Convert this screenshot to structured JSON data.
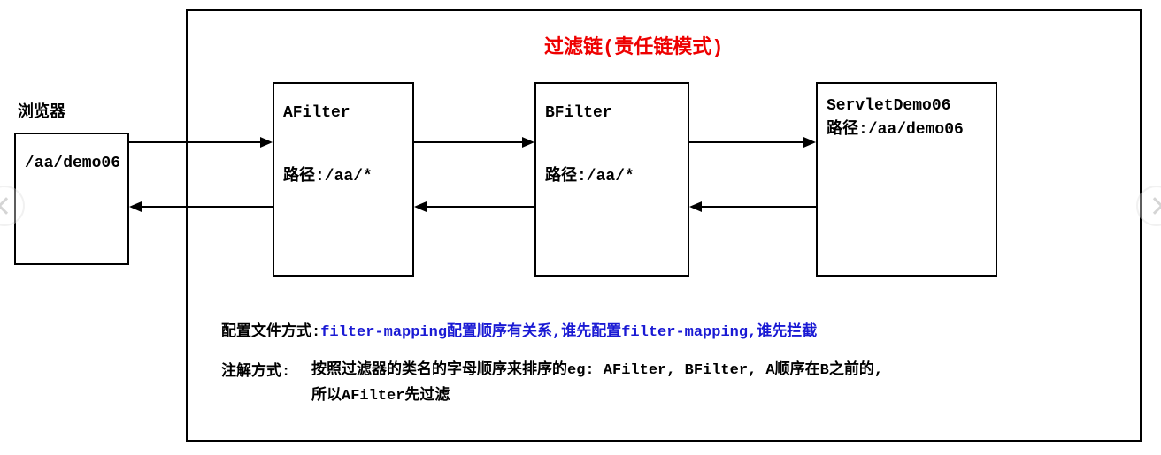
{
  "title": "过滤链(责任链模式)",
  "browser": {
    "label": "浏览器",
    "path": "/aa/demo06"
  },
  "boxes": {
    "afilter": {
      "name": "AFilter",
      "path_label": "路径:/aa/*"
    },
    "bfilter": {
      "name": "BFilter",
      "path_label": "路径:/aa/*"
    },
    "servlet": {
      "name": "ServletDemo06",
      "path_label": "路径:/aa/demo06"
    }
  },
  "notes": {
    "config": {
      "label": "配置文件方式:",
      "text": "filter-mapping配置顺序有关系,谁先配置filter-mapping,谁先拦截"
    },
    "annotation": {
      "label": "注解方式:",
      "text_line1": "按照过滤器的类名的字母顺序来排序的eg: AFilter, BFilter, A顺序在B之前的,",
      "text_line2": "所以AFilter先过滤"
    }
  },
  "nav": {
    "prev": "chevron-left-icon",
    "next": "chevron-right-icon"
  }
}
